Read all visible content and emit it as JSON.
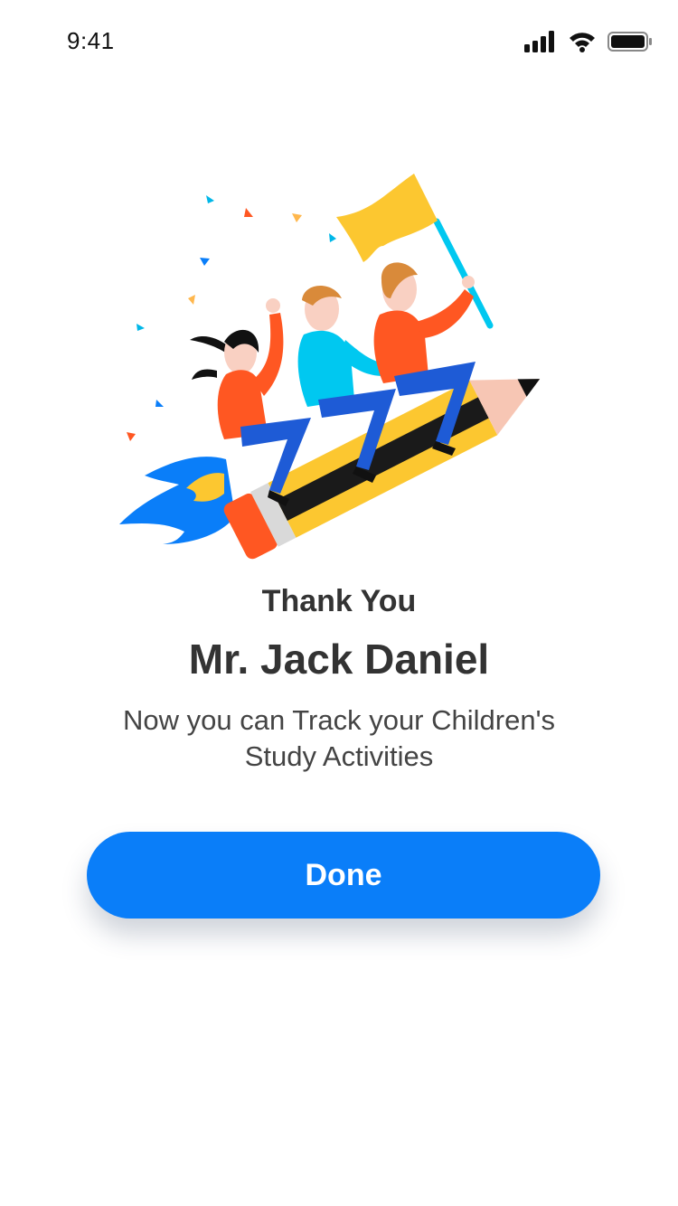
{
  "status_bar": {
    "time": "9:41",
    "icons": [
      "signal-icon",
      "wifi-icon",
      "battery-icon"
    ]
  },
  "content": {
    "title": "Thank You",
    "name": "Mr. Jack Daniel",
    "message": "Now you can Track your Children's Study Activities"
  },
  "actions": {
    "done_label": "Done"
  },
  "colors": {
    "primary": "#0a7ef9",
    "text": "#333333",
    "accent_yellow": "#fcc730",
    "accent_orange": "#ff5722",
    "accent_cyan": "#00c8f0"
  }
}
